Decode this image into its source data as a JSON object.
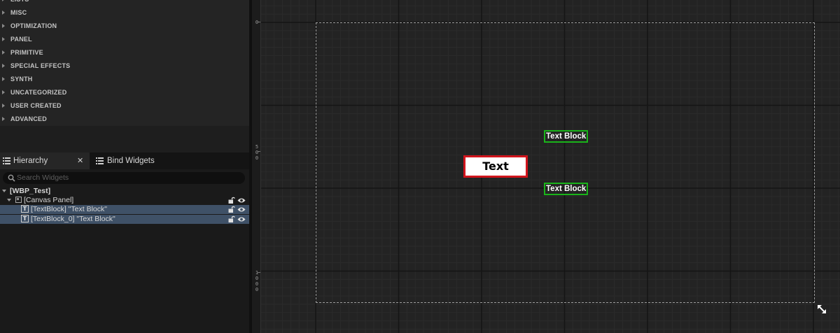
{
  "palette": {
    "categories": [
      {
        "label": "LISTS"
      },
      {
        "label": "MISC"
      },
      {
        "label": "OPTIMIZATION"
      },
      {
        "label": "PANEL"
      },
      {
        "label": "PRIMITIVE"
      },
      {
        "label": "SPECIAL EFFECTS"
      },
      {
        "label": "SYNTH"
      },
      {
        "label": "UNCATEGORIZED"
      },
      {
        "label": "USER CREATED"
      },
      {
        "label": "ADVANCED"
      }
    ]
  },
  "tabs": {
    "hierarchy": "Hierarchy",
    "bind_widgets": "Bind Widgets",
    "close_glyph": "✕"
  },
  "search": {
    "placeholder": "Search Widgets"
  },
  "tree": {
    "root": "[WBP_Test]",
    "canvas_panel": "[Canvas Panel]",
    "items": [
      {
        "label": "[TextBlock] \"Text Block\""
      },
      {
        "label": "[TextBlock_0] \"Text Block\""
      }
    ],
    "text_glyph": "T"
  },
  "designer": {
    "ruler_labels": [
      "0",
      "500",
      "1000"
    ],
    "text_blocks": [
      {
        "label": "Text Block"
      },
      {
        "label": "Text Block"
      }
    ],
    "text_widget_label": "Text",
    "colors": {
      "selection_green": "#1ab41a",
      "selection_red": "#d0141c",
      "tree_selected": "#3f5167"
    }
  }
}
